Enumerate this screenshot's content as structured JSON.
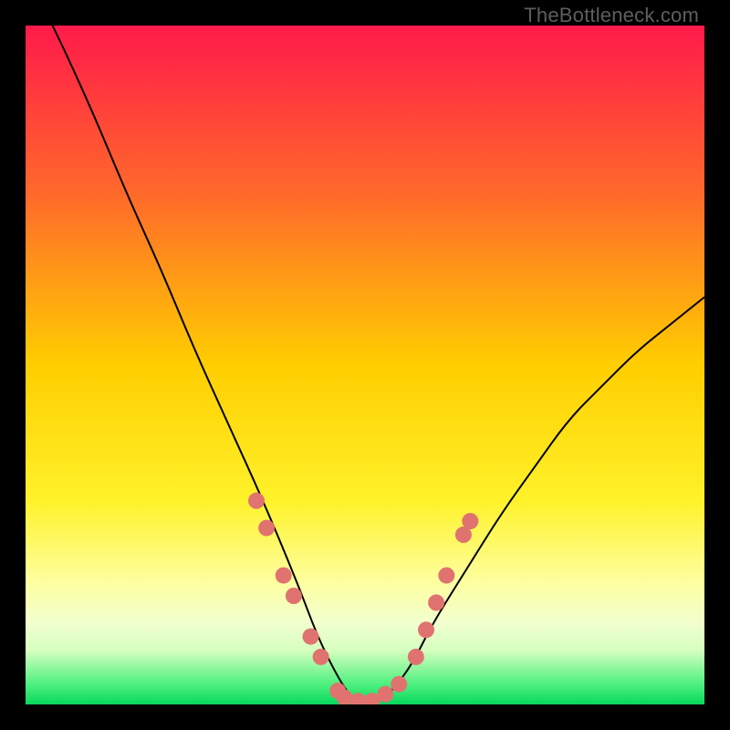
{
  "watermark": "TheBottleneck.com",
  "colors": {
    "frame": "#000000",
    "gradient_top": "#ff1a4a",
    "gradient_mid_upper": "#ff7a2e",
    "gradient_mid": "#ffd500",
    "gradient_mid_lower": "#f8ff6e",
    "gradient_band_light": "#ecffb0",
    "gradient_bottom": "#13e86a",
    "curve": "#000000",
    "markers": "#e0736f"
  },
  "chart_data": {
    "type": "line",
    "title": "",
    "xlabel": "",
    "ylabel": "",
    "xlim": [
      0,
      100
    ],
    "ylim": [
      0,
      100
    ],
    "series": [
      {
        "name": "bottleneck-curve",
        "x": [
          0,
          5,
          10,
          15,
          20,
          25,
          30,
          35,
          40,
          43,
          46,
          48,
          50,
          52,
          54,
          57,
          60,
          65,
          70,
          75,
          80,
          85,
          90,
          95,
          100
        ],
        "y": [
          108,
          98,
          87,
          75,
          64,
          52,
          41,
          30,
          18,
          10,
          4,
          1,
          0,
          0.5,
          2,
          6,
          12,
          20,
          28,
          35,
          42,
          47,
          52,
          56,
          60
        ]
      }
    ],
    "markers": [
      {
        "x": 34,
        "y": 30
      },
      {
        "x": 35.5,
        "y": 26
      },
      {
        "x": 38,
        "y": 19
      },
      {
        "x": 39.5,
        "y": 16
      },
      {
        "x": 42,
        "y": 10
      },
      {
        "x": 43.5,
        "y": 7
      },
      {
        "x": 46,
        "y": 2
      },
      {
        "x": 47,
        "y": 1
      },
      {
        "x": 49,
        "y": 0.5
      },
      {
        "x": 51,
        "y": 0.5
      },
      {
        "x": 53,
        "y": 1.5
      },
      {
        "x": 55,
        "y": 3
      },
      {
        "x": 57.5,
        "y": 7
      },
      {
        "x": 59,
        "y": 11
      },
      {
        "x": 60.5,
        "y": 15
      },
      {
        "x": 62,
        "y": 19
      },
      {
        "x": 64.5,
        "y": 25
      },
      {
        "x": 65.5,
        "y": 27
      }
    ]
  }
}
